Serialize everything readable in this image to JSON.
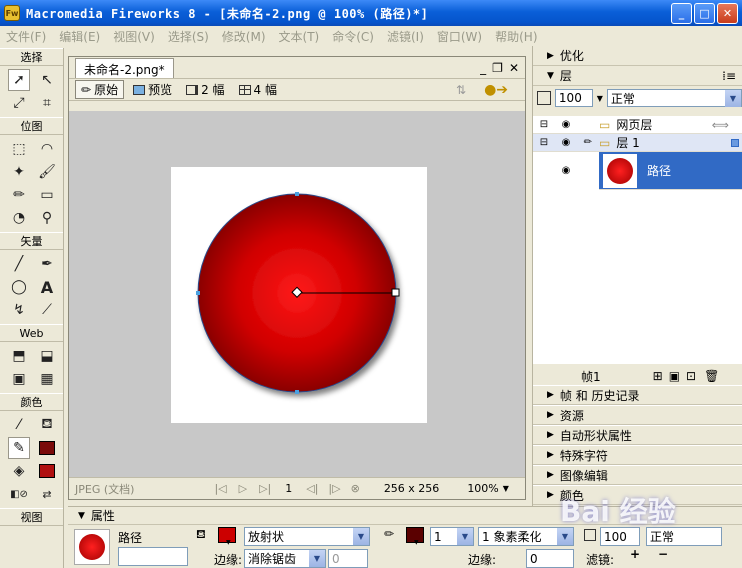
{
  "window": {
    "app_logo_text": "Fw",
    "title": "Macromedia Fireworks 8 - [未命名-2.png @ 100% (路径)*]",
    "minimize": "_",
    "maximize": "□",
    "close": "✕"
  },
  "menu": [
    "文件(F)",
    "编辑(E)",
    "视图(V)",
    "选择(S)",
    "修改(M)",
    "文本(T)",
    "命令(C)",
    "滤镜(I)",
    "窗口(W)",
    "帮助(H)"
  ],
  "toolbox": {
    "sections": {
      "select": "选择",
      "bitmap": "位图",
      "vector": "矢量",
      "web": "Web",
      "colors": "颜色",
      "view": "视图"
    },
    "stroke_color": "#7a0a0a",
    "fill_color": "#b01010"
  },
  "document": {
    "tab": "未命名-2.png*",
    "views": [
      "原始",
      "预览",
      "2 幅",
      "4 幅"
    ],
    "status": {
      "format": "JPEG (文档)",
      "frame": "1",
      "size": "256 x 256",
      "zoom": "100%"
    }
  },
  "panels": {
    "optimize": "优化",
    "layers": "层",
    "opacity": "100",
    "blend_mode": "正常",
    "layer_rows": [
      {
        "name": "网页层"
      },
      {
        "name": "层 1"
      },
      {
        "name": "路径"
      }
    ],
    "frame_label": "帧1",
    "collapsed": [
      "帧 和 历史记录",
      "资源",
      "自动形状属性",
      "特殊字符",
      "图像编辑",
      "颜色"
    ]
  },
  "properties": {
    "title": "属性",
    "object_name": "路径",
    "fill_type": "放射状",
    "fill_color": "#cc0000",
    "stroke_color": "#5a0000",
    "stroke_size": "1",
    "stroke_type": "1 象素柔化",
    "edge_label": "边缘:",
    "edge_value": "消除锯齿",
    "edge_amount": "0",
    "stroke_edge_label": "边缘:",
    "stroke_edge_value": "0",
    "opacity": "100",
    "blend": "正常",
    "filters_label": "滤镜:"
  },
  "watermark": "Bai 经验"
}
